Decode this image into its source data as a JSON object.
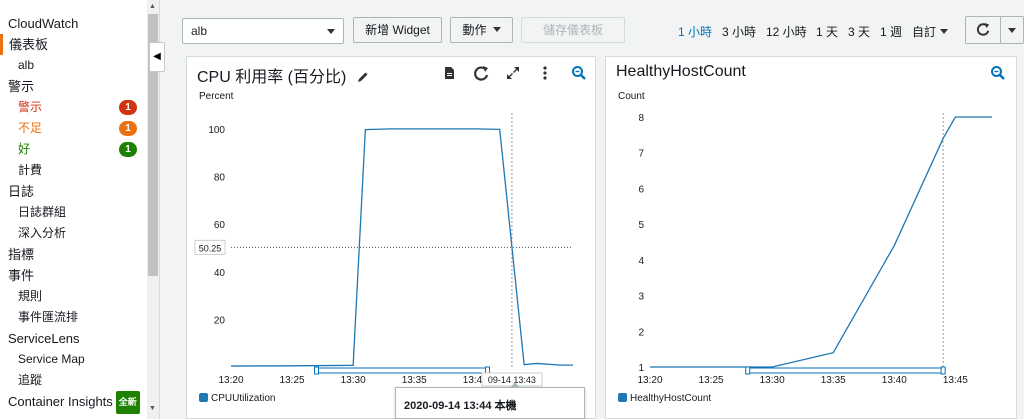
{
  "sidebar": {
    "title": "CloudWatch",
    "dashboards_label": "儀表板",
    "dashboard_item": "alb",
    "alarms_label": "警示",
    "alarm_items": [
      {
        "label": "警示",
        "count": "1"
      },
      {
        "label": "不足",
        "count": "1"
      },
      {
        "label": "好",
        "count": "1"
      }
    ],
    "billing": "計費",
    "logs_label": "日誌",
    "log_items": [
      "日誌群組",
      "深入分析"
    ],
    "metrics_label": "指標",
    "events_label": "事件",
    "event_items": [
      "規則",
      "事件匯流排"
    ],
    "servicelens_label": "ServiceLens",
    "servicelens_items": [
      "Service Map",
      "追蹤"
    ],
    "container_insights_label": "Container Insights",
    "new_badge": "全新"
  },
  "toolbar": {
    "dashboard_selected": "alb",
    "add_widget": "新增 Widget",
    "actions": "動作",
    "save_dashboard": "儲存儀表板",
    "time_ranges": [
      "1 小時",
      "3 小時",
      "12 小時",
      "1 天",
      "3 天",
      "1 週"
    ],
    "custom": "自訂"
  },
  "cpu_panel": {
    "title": "CPU 利用率 (百分比)",
    "unit": "Percent",
    "crosshair_value": "50.25",
    "crosshair_time": "09-14 13:43",
    "legend": "CPUUtilization"
  },
  "health_panel": {
    "title": "HealthyHostCount",
    "unit": "Count",
    "legend": "HealthyHostCount"
  },
  "tooltip": {
    "text": "2020-09-14 13:44 本機"
  },
  "colors": {
    "series": "#1f77b4",
    "accent": "#0073bb",
    "alarm_red": "#d13212",
    "insufficient_orange": "#ec7211",
    "ok_green": "#1d8102"
  },
  "chart_data": [
    {
      "type": "line",
      "title": "CPU 利用率 (百分比)",
      "ylabel": "Percent",
      "x": [
        "13:20",
        "13:25",
        "13:30",
        "13:31",
        "13:33",
        "13:35",
        "13:38",
        "13:40",
        "13:42",
        "13:44",
        "13:45",
        "13:47",
        "13:48"
      ],
      "xticks": [
        "13:20",
        "13:25",
        "13:30",
        "13:35",
        "13:40"
      ],
      "yticks": [
        20,
        40,
        60,
        80,
        100
      ],
      "ylim": [
        0,
        105
      ],
      "series": [
        {
          "name": "CPUUtilization",
          "values": [
            0.4,
            0.5,
            0.7,
            99.7,
            100,
            100,
            100,
            100,
            99.8,
            1,
            1.5,
            0.8,
            0.8
          ]
        }
      ]
    },
    {
      "type": "line",
      "title": "HealthyHostCount",
      "ylabel": "Count",
      "x": [
        "13:20",
        "13:25",
        "13:30",
        "13:35",
        "13:40",
        "13:44",
        "13:45",
        "13:48"
      ],
      "xticks": [
        "13:20",
        "13:25",
        "13:30",
        "13:35",
        "13:40",
        "13:45"
      ],
      "yticks": [
        1,
        2,
        3,
        4,
        5,
        6,
        7,
        8
      ],
      "ylim": [
        1,
        8
      ],
      "series": [
        {
          "name": "HealthyHostCount",
          "values": [
            1,
            1,
            1,
            1.4,
            4.4,
            7.4,
            8,
            8
          ]
        }
      ]
    }
  ]
}
